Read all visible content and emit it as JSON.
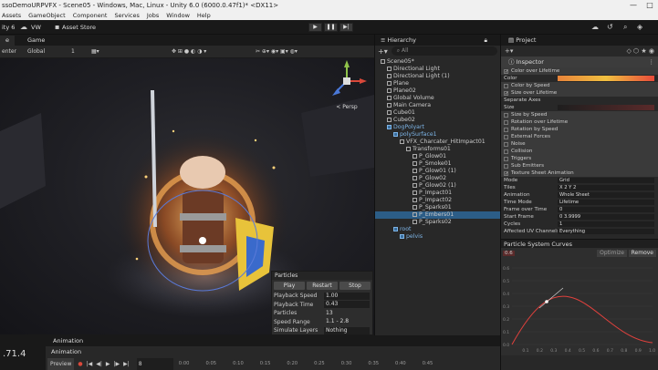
{
  "window": {
    "title": "ssoDemoURPVFX - Scene05 - Windows, Mac, Linux - Unity 6.0 (6000.0.47f1)* <DX11>",
    "controls": [
      "—",
      "□"
    ]
  },
  "menu": [
    "Assets",
    "GameObject",
    "Component",
    "Services",
    "Jobs",
    "Window",
    "Help"
  ],
  "toolbar": {
    "account": "ity 6",
    "vw": "VW",
    "asset_store": "Asset Store"
  },
  "scene_tabs": [
    "e",
    "Game"
  ],
  "scene_toolbar": {
    "pivot": "enter",
    "space": "Global",
    "snap": "1"
  },
  "gizmo": {
    "persp_label": "< Persp"
  },
  "particles": {
    "title": "Particles",
    "buttons": [
      "Play",
      "Restart",
      "Stop"
    ],
    "rows": [
      {
        "label": "Playback Speed",
        "value": "1.00"
      },
      {
        "label": "Playback Time",
        "value": "0.43"
      },
      {
        "label": "Particles",
        "value": "13"
      },
      {
        "label": "Speed Range",
        "value": "1.1 - 2.8"
      },
      {
        "label": "Simulate Layers",
        "value": "Nothing"
      }
    ]
  },
  "stats": {
    "value": ".71.4"
  },
  "animation": {
    "tab": "Animation",
    "panel_tab": "Animation",
    "preview_label": "Preview",
    "frame": "8",
    "timeline_marks": [
      "0:00",
      "0:05",
      "0:10",
      "0:15",
      "0:20",
      "0:25",
      "0:30",
      "0:35",
      "0:40",
      "0:45"
    ]
  },
  "hierarchy": {
    "tab": "Hierarchy",
    "search_placeholder": "All",
    "items": [
      {
        "label": "Scene05*",
        "indent": 0,
        "kind": "scene"
      },
      {
        "label": "Directional Light",
        "indent": 1,
        "kind": "obj"
      },
      {
        "label": "Directional Light (1)",
        "indent": 1,
        "kind": "obj"
      },
      {
        "label": "Plane",
        "indent": 1,
        "kind": "obj"
      },
      {
        "label": "Plane02",
        "indent": 1,
        "kind": "obj"
      },
      {
        "label": "Global Volume",
        "indent": 1,
        "kind": "obj"
      },
      {
        "label": "Main Camera",
        "indent": 1,
        "kind": "obj"
      },
      {
        "label": "Cube01",
        "indent": 1,
        "kind": "obj"
      },
      {
        "label": "Cube02",
        "indent": 1,
        "kind": "obj"
      },
      {
        "label": "DogPolyart",
        "indent": 1,
        "kind": "prefab"
      },
      {
        "label": "polySurface1",
        "indent": 2,
        "kind": "prefab"
      },
      {
        "label": "VFX_Charcater_HitImpact01",
        "indent": 3,
        "kind": "obj"
      },
      {
        "label": "Transforms01",
        "indent": 4,
        "kind": "obj"
      },
      {
        "label": "P_Glow01",
        "indent": 5,
        "kind": "obj"
      },
      {
        "label": "P_Smoke01",
        "indent": 5,
        "kind": "obj"
      },
      {
        "label": "P_Glow01 (1)",
        "indent": 5,
        "kind": "obj"
      },
      {
        "label": "P_Glow02",
        "indent": 5,
        "kind": "obj"
      },
      {
        "label": "P_Glow02 (1)",
        "indent": 5,
        "kind": "obj"
      },
      {
        "label": "P_Impact01",
        "indent": 5,
        "kind": "obj"
      },
      {
        "label": "P_Impact02",
        "indent": 5,
        "kind": "obj"
      },
      {
        "label": "P_Sparks01",
        "indent": 5,
        "kind": "obj"
      },
      {
        "label": "P_Embers01",
        "indent": 5,
        "kind": "selected"
      },
      {
        "label": "P_Sparks02",
        "indent": 5,
        "kind": "obj"
      },
      {
        "label": "root",
        "indent": 2,
        "kind": "prefab"
      },
      {
        "label": "pelvis",
        "indent": 3,
        "kind": "prefab"
      }
    ]
  },
  "project": {
    "tab": "Project"
  },
  "inspector": {
    "tab": "Inspector",
    "rows": [
      {
        "label": "Color over Lifetime",
        "checked": true,
        "field": "",
        "mod": true
      },
      {
        "label": "Color",
        "checked": null,
        "field": "gradient",
        "mod": false
      },
      {
        "label": "Color by Speed",
        "checked": false,
        "field": "",
        "mod": true
      },
      {
        "label": "Size over Lifetime",
        "checked": true,
        "field": "",
        "mod": true
      },
      {
        "label": "Separate Axes",
        "checked": null,
        "field": "",
        "mod": false
      },
      {
        "label": "Size",
        "checked": null,
        "field": "curve",
        "mod": false
      },
      {
        "label": "Size by Speed",
        "checked": false,
        "field": "",
        "mod": true
      },
      {
        "label": "Rotation over Lifetime",
        "checked": false,
        "field": "",
        "mod": true
      },
      {
        "label": "Rotation by Speed",
        "checked": false,
        "field": "",
        "mod": true
      },
      {
        "label": "External Forces",
        "checked": false,
        "field": "",
        "mod": true
      },
      {
        "label": "Noise",
        "checked": false,
        "field": "",
        "mod": true
      },
      {
        "label": "Collision",
        "checked": false,
        "field": "",
        "mod": true
      },
      {
        "label": "Triggers",
        "checked": false,
        "field": "",
        "mod": true
      },
      {
        "label": "Sub Emitters",
        "checked": false,
        "field": "",
        "mod": true
      },
      {
        "label": "Texture Sheet Animation",
        "checked": true,
        "field": "",
        "mod": true
      },
      {
        "label": "Mode",
        "checked": null,
        "field": "Grid",
        "mod": false
      },
      {
        "label": "Tiles",
        "checked": null,
        "field": "X 2            Y 2",
        "mod": false
      },
      {
        "label": "Animation",
        "checked": null,
        "field": "Whole Sheet",
        "mod": false
      },
      {
        "label": "Time Mode",
        "checked": null,
        "field": "Lifetime",
        "mod": false
      },
      {
        "label": "Frame over Time",
        "checked": null,
        "field": "0",
        "mod": false
      },
      {
        "label": "Start Frame",
        "checked": null,
        "field": "0                  3.9999",
        "mod": false
      },
      {
        "label": "Cycles",
        "checked": null,
        "field": "1",
        "mod": false
      },
      {
        "label": "Affected UV Channels",
        "checked": null,
        "field": "Everything",
        "mod": false
      }
    ],
    "curves": {
      "title": "Particle System Curves",
      "optimize": "Optimize",
      "remove": "Remove",
      "scale": "0.6",
      "y_ticks": [
        "0.6",
        "0.5",
        "0.4",
        "0.3",
        "0.2",
        "0.1",
        "0.0"
      ],
      "x_ticks": [
        "0.1",
        "0.2",
        "0.3",
        "0.4",
        "0.5",
        "0.6",
        "0.7",
        "0.8",
        "0.9",
        "1.0"
      ],
      "curve_color": "#e0413d"
    }
  }
}
